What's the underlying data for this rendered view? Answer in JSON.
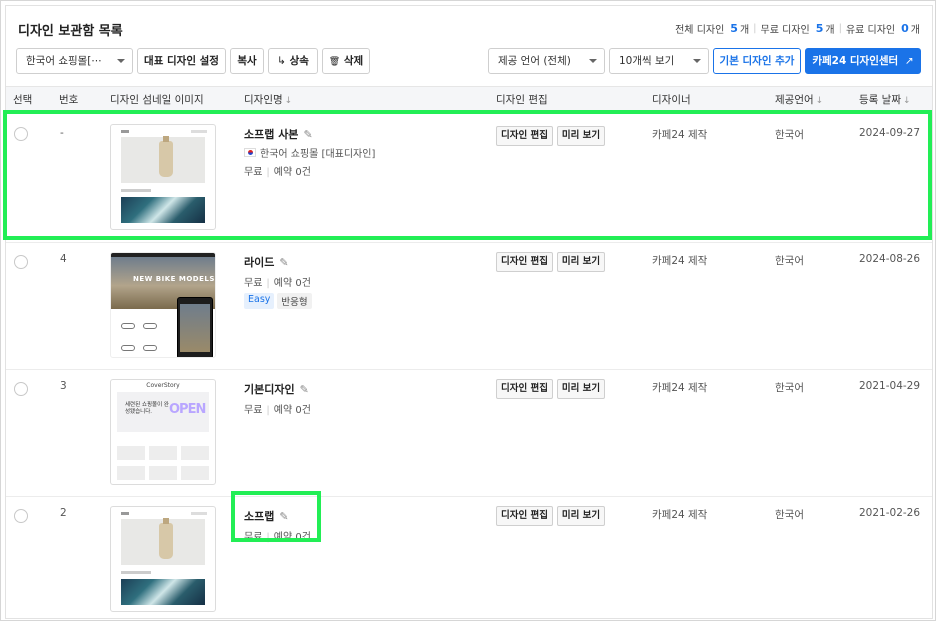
{
  "header": {
    "title": "디자인 보관함 목록"
  },
  "summary": {
    "total_label": "전체 디자인",
    "total_count": "5",
    "total_unit": "개",
    "free_label": "무료 디자인",
    "free_count": "5",
    "free_unit": "개",
    "paid_label": "유료 디자인",
    "paid_count": "0",
    "paid_unit": "개"
  },
  "toolbar": {
    "shop_select": "한국어 쇼핑몰[⋯",
    "set_default": "대표 디자인 설정",
    "copy": "복사",
    "inherit": "상속",
    "inherit_icon": "↳",
    "delete": "삭제",
    "delete_icon": "🗑",
    "language_select": "제공 언어 (전체)",
    "page_size_select": "10개씩 보기",
    "add_default": "기본 디자인 추가",
    "design_center": "카페24 디자인센터",
    "external_icon": "↗"
  },
  "table": {
    "columns": {
      "select": "선택",
      "number": "번호",
      "thumbnail": "디자인 섬네일 이미지",
      "name": "디자인명",
      "edit": "디자인 편집",
      "designer": "디자이너",
      "language": "제공언어",
      "date": "등록 날짜"
    },
    "sort_icon": "↓",
    "edit_label": "디자인 편집",
    "preview_label": "미리 보기",
    "rows": [
      {
        "number": "-",
        "name": "소프랩 사본",
        "shop": "한국어 쇼핑몰 [대표디자인]",
        "price": "무료",
        "reservation": "예약 0건",
        "designer": "카페24 제작",
        "language": "한국어",
        "date": "2024-09-27"
      },
      {
        "number": "4",
        "name": "라이드",
        "price": "무료",
        "reservation": "예약 0건",
        "tag_easy": "Easy",
        "tag_responsive": "반응형",
        "thumb_text": "NEW BIKE MODELS",
        "designer": "카페24 제작",
        "language": "한국어",
        "date": "2024-08-26"
      },
      {
        "number": "3",
        "name": "기본디자인",
        "price": "무료",
        "reservation": "예약 0건",
        "thumb_logo": "CoverStory",
        "thumb_text": "세련된 쇼핑몰이 완성됐습니다.",
        "thumb_badge": "OPEN",
        "designer": "카페24 제작",
        "language": "한국어",
        "date": "2021-04-29"
      },
      {
        "number": "2",
        "name": "소프랩",
        "price": "무료",
        "reservation": "예약 0건",
        "designer": "카페24 제작",
        "language": "한국어",
        "date": "2021-02-26"
      }
    ]
  },
  "icons": {
    "pencil": "✎",
    "radio": "radio-empty",
    "flag": "korea-flag"
  },
  "colors": {
    "accent": "#1a73e8",
    "highlight": "#22ee55"
  }
}
